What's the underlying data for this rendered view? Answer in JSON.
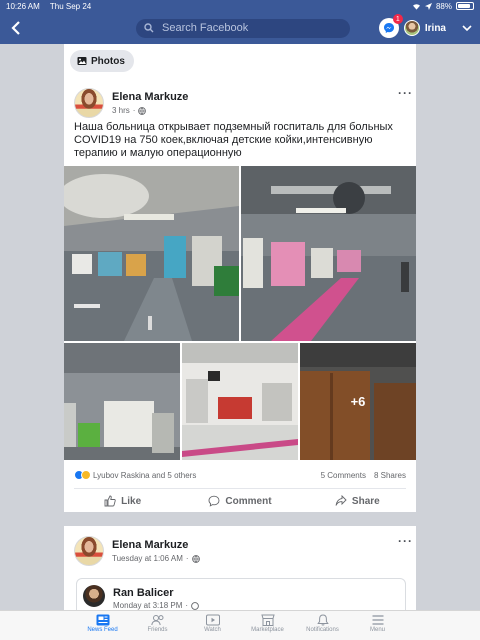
{
  "status": {
    "time": "10:26 AM",
    "date": "Thu Sep 24",
    "battery": "88%",
    "battery_level": 0.88
  },
  "header": {
    "search_placeholder": "Search Facebook",
    "messenger_badge": "1",
    "user_name": "Irina"
  },
  "post1": {
    "chip": "Photos",
    "author": "Elena Markuze",
    "time": "3 hrs",
    "text": "Наша больница открывает подземный госпиталь для больных COVID19 на 750 коек,включая детские койки,интенсивную терапию и малую операционную",
    "more_photos": "+6",
    "reactions_text": "Lyubov  Raskina and 5 others",
    "comments": "5 Comments",
    "shares": "8 Shares",
    "actions": {
      "like": "Like",
      "comment": "Comment",
      "share": "Share"
    }
  },
  "post2": {
    "author": "Elena Markuze",
    "time": "Tuesday at 1:06 AM",
    "shared_author": "Ran Balicer",
    "shared_time": "Monday at 3:18 PM"
  },
  "tabs": [
    {
      "label": "News Feed",
      "icon": "news-feed-icon",
      "active": true
    },
    {
      "label": "Friends",
      "icon": "friends-icon",
      "active": false
    },
    {
      "label": "Watch",
      "icon": "watch-icon",
      "active": false
    },
    {
      "label": "Marketplace",
      "icon": "marketplace-icon",
      "active": false
    },
    {
      "label": "Notifications",
      "icon": "bell-icon",
      "active": false
    },
    {
      "label": "Menu",
      "icon": "menu-icon",
      "active": false
    }
  ],
  "colors": {
    "brand": "#3b5998",
    "accent": "#1877f2",
    "badge": "#f02849"
  }
}
